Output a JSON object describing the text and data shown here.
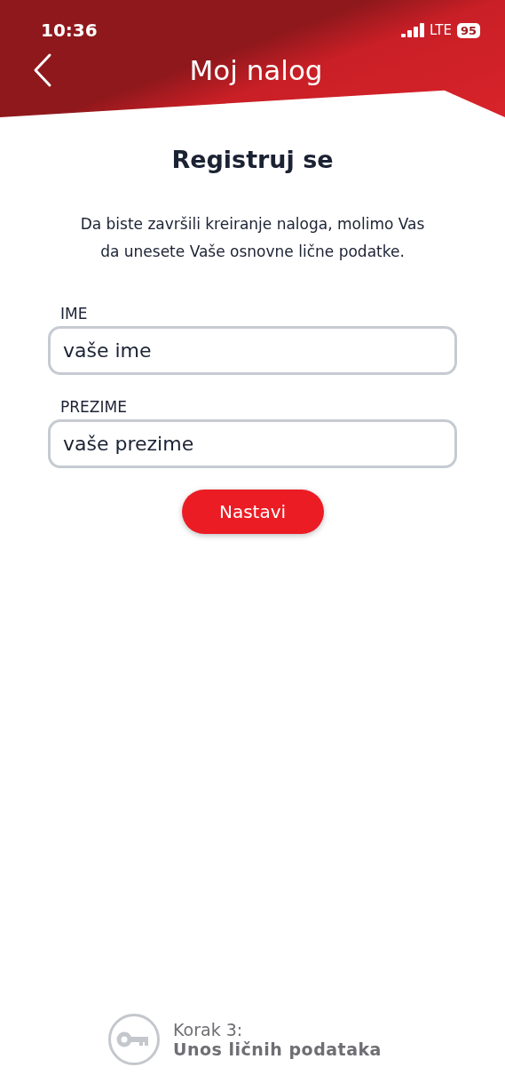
{
  "status_bar": {
    "time": "10:36",
    "network": "LTE",
    "battery": "95"
  },
  "header": {
    "title": "Moj nalog"
  },
  "heading": "Registruj se",
  "intro": "Da biste završili kreiranje naloga, molimo Vas da unesete Vaše osnovne lične podatke.",
  "fields": [
    {
      "label": "IME",
      "placeholder": "vaše ime"
    },
    {
      "label": "PREZIME",
      "placeholder": "vaše prezime"
    }
  ],
  "button": "Nastavi",
  "step": {
    "label": "Korak 3:",
    "title": "Unos ličnih podataka"
  }
}
